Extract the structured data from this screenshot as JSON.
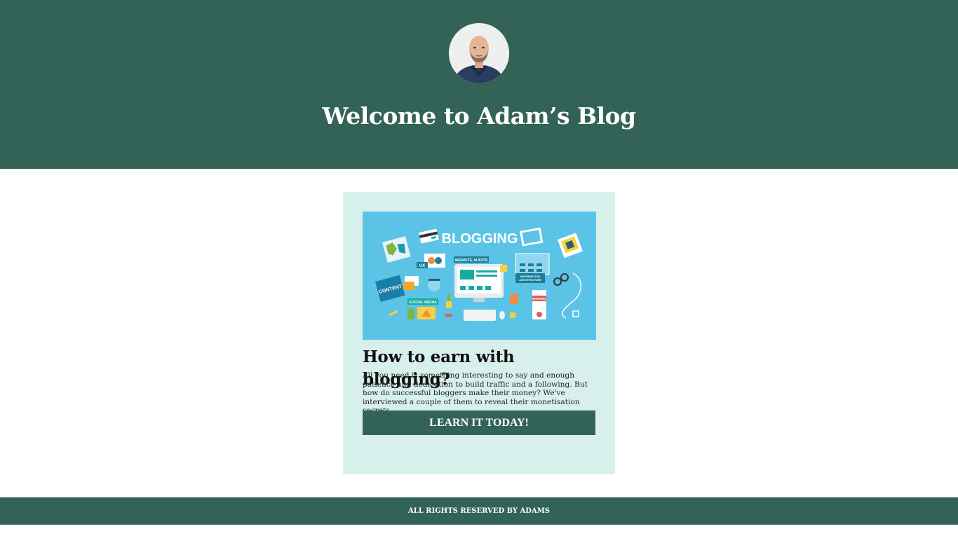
{
  "header": {
    "title": "Welcome to Adam’s Blog",
    "avatar_icon": "author-avatar-photo"
  },
  "post": {
    "image": {
      "icon": "blogging-illustration",
      "label": "BLOGGING",
      "tags": {
        "ux": "UX",
        "website_audits": "WEBSITE AUDITS",
        "information_architecture": "INFORMATION ARCHITECTURE",
        "content": "CONTENT",
        "social_media": "SOCIAL MEDIA",
        "writing": "WRITING"
      }
    },
    "title": "How to earn with blogging?",
    "body": "All you need is something interesting to say and enough patience and dedication to build traffic and a following. But how do successful bloggers make their money? We've interviewed a couple of them to reveal their monetisation secrets.",
    "cta_label": "LEARN IT TODAY!"
  },
  "footer": {
    "text": "ALL RIGHTS RESERVED BY ADAMS"
  },
  "colors": {
    "brand": "#336356",
    "card_bg": "#d8f0eb",
    "hero_bg": "#5bc3e6"
  }
}
